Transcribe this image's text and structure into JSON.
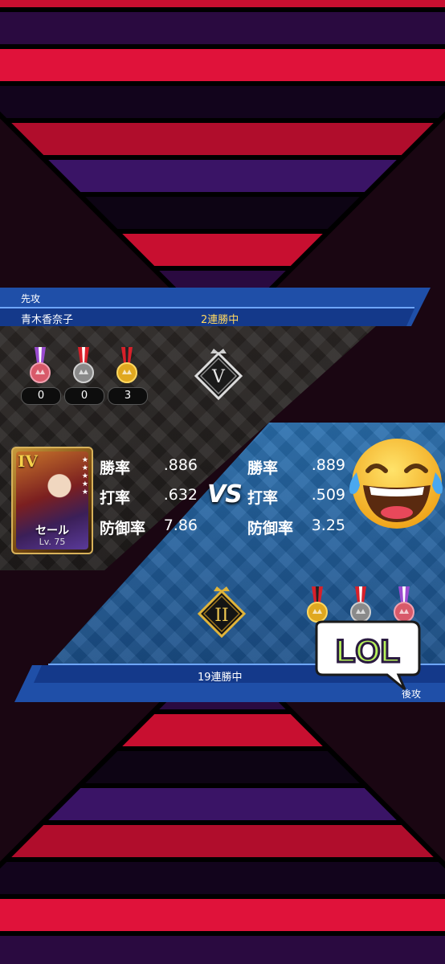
{
  "top_player": {
    "turn_label": "先攻",
    "name": "青木香奈子",
    "streak": "2連勝中",
    "medals": [
      {
        "kind": "purple-medal",
        "count": "0"
      },
      {
        "kind": "red-medal",
        "count": "0"
      },
      {
        "kind": "gold-medal",
        "count": "3"
      }
    ],
    "rank_icon": "V",
    "card": {
      "rank": "IV",
      "name": "セール",
      "level": "Lv. 75"
    },
    "stats": [
      {
        "label": "勝率",
        "value": ".886"
      },
      {
        "label": "打率",
        "value": ".632"
      },
      {
        "label": "防御率",
        "value": "7.86"
      }
    ]
  },
  "versus_label": "VS",
  "bottom_player": {
    "turn_label": "後攻",
    "streak": "19連勝中",
    "rank_icon": "II",
    "stats": [
      {
        "label": "勝率",
        "value": ".889"
      },
      {
        "label": "打率",
        "value": ".509"
      },
      {
        "label": "防御率",
        "value": "3.25"
      }
    ]
  },
  "overlays": {
    "sticker_text": "LOL",
    "emoji": "laughing-with-tears-emoji"
  },
  "colors": {
    "band_blue": "#1f4fa8",
    "gold": "#e0b43a",
    "accent_red": "#e0123a"
  }
}
